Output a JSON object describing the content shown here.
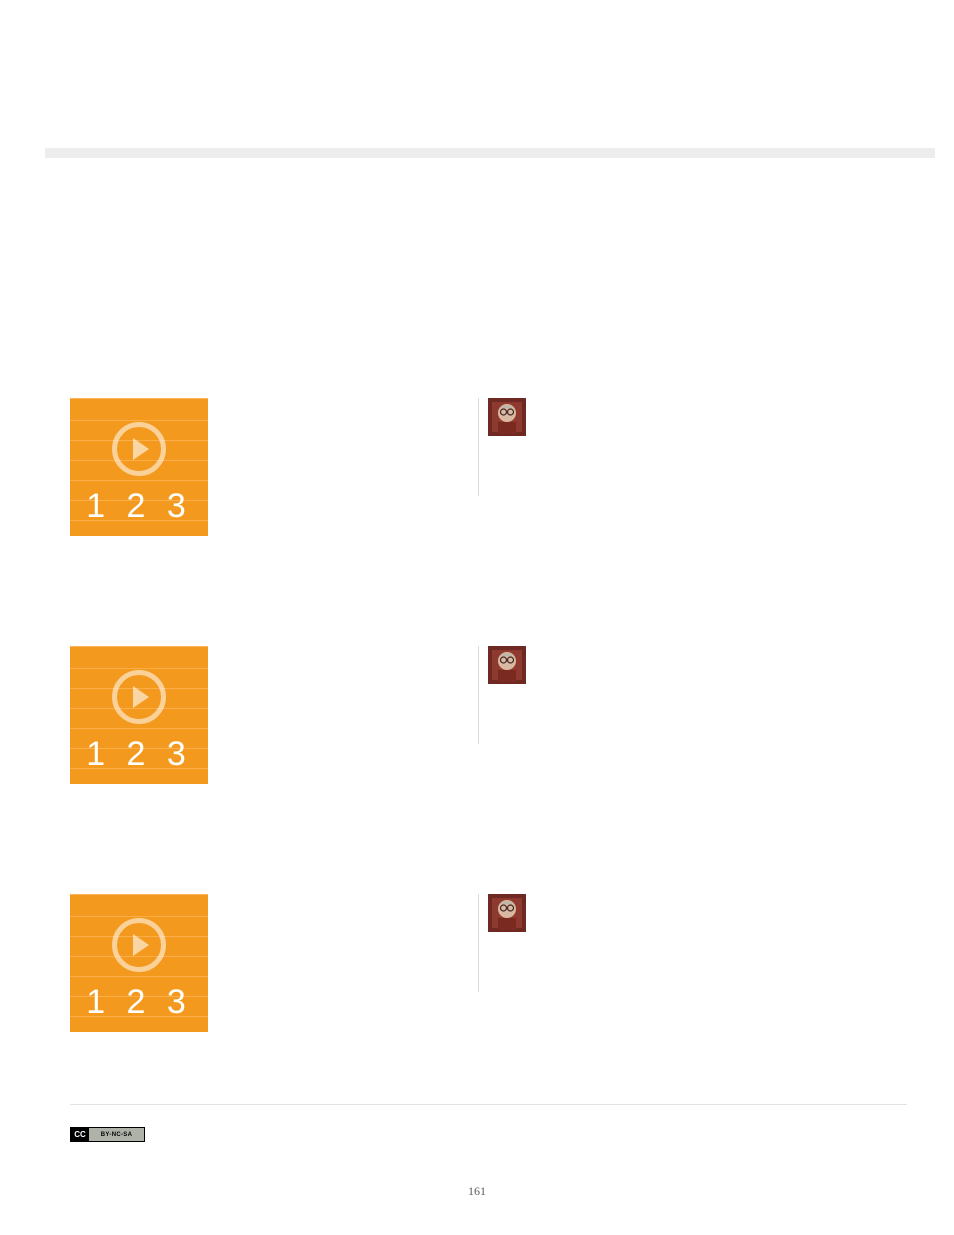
{
  "thumbnail": {
    "numbers_text": "1 2 3",
    "icon_meaning": "play-icon"
  },
  "items": [
    {
      "has_avatar": true
    },
    {
      "has_avatar": true
    },
    {
      "has_avatar": true
    }
  ],
  "license": {
    "badge_prefix": "CC",
    "badge_text": "BY-NC-SA"
  },
  "page_number": "161"
}
